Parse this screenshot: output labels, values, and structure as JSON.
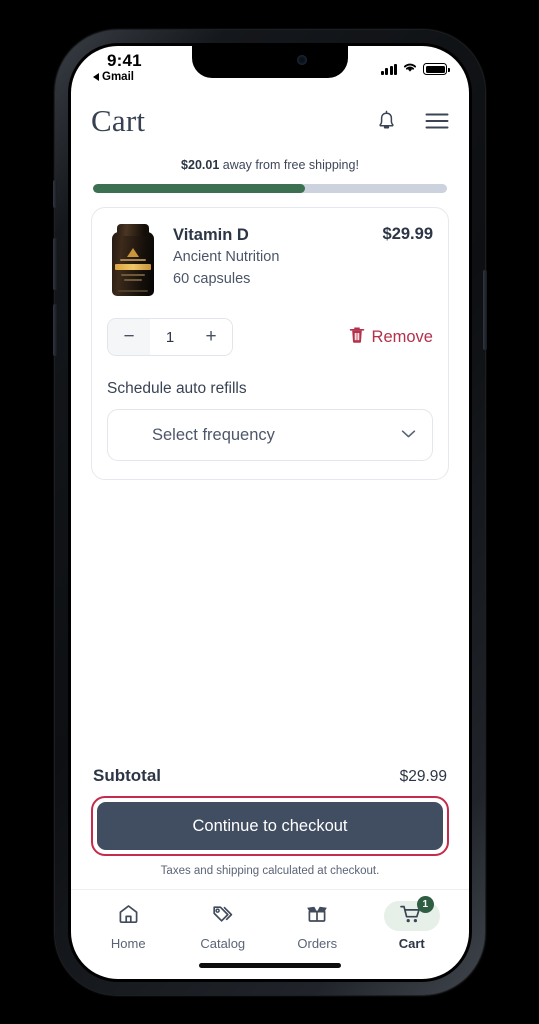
{
  "status_bar": {
    "time": "9:41",
    "back_app": "Gmail",
    "signal_icon": "signal-bars-icon",
    "wifi_icon": "wifi-icon",
    "battery_icon": "battery-full-icon"
  },
  "header": {
    "title": "Cart",
    "notifications_icon": "bell-icon",
    "menu_icon": "hamburger-menu-icon"
  },
  "shipping": {
    "amount": "$20.01",
    "message": " away from free shipping!",
    "progress_percent": 60,
    "fill_color": "#3d7050",
    "track_color": "#ccd2de"
  },
  "cart_item": {
    "thumbnail_icon": "supplement-bottle-image",
    "name": "Vitamin D",
    "brand": "Ancient Nutrition",
    "variant": "60 capsules",
    "price": "$29.99",
    "quantity": "1",
    "decrement_label": "−",
    "increment_label": "+",
    "remove_label": "Remove",
    "remove_icon": "trash-icon",
    "remove_color": "#b5304a",
    "refill_label": "Schedule auto refills",
    "frequency_value": "Select frequency",
    "frequency_chevron_icon": "chevron-down-icon"
  },
  "summary": {
    "subtotal_label": "Subtotal",
    "subtotal_value": "$29.99",
    "checkout_label": "Continue to checkout",
    "checkout_color": "#414d60",
    "highlight_color": "#c52b4a",
    "tax_note": "Taxes and shipping calculated at checkout."
  },
  "bottom_nav": {
    "items": [
      {
        "label": "Home",
        "icon": "home-icon",
        "active": false
      },
      {
        "label": "Catalog",
        "icon": "tags-icon",
        "active": false
      },
      {
        "label": "Orders",
        "icon": "open-box-icon",
        "active": false
      },
      {
        "label": "Cart",
        "icon": "shopping-cart-icon",
        "active": true,
        "badge": "1"
      }
    ],
    "badge_color": "#2f5d42",
    "active_pill_color": "#e6efe8"
  }
}
